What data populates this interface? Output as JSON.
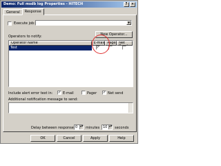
{
  "window": {
    "title": "Demo: Full msdb log Properties - HITECH",
    "buttons": {
      "help": "?",
      "close": "×"
    }
  },
  "tabs": [
    {
      "label": "General",
      "active": false
    },
    {
      "label": "Response",
      "active": true
    }
  ],
  "response": {
    "execute_job_label": "Execute job:",
    "execute_job_checked": false,
    "execute_job_value": "",
    "operators_label": "Operators to notify:",
    "new_operator_button": "New Operator...",
    "grid": {
      "headers": [
        "Operator Name",
        "E-mail",
        "Pager",
        "Net Send"
      ],
      "rows": [
        {
          "name": "Test",
          "email": true,
          "pager": false,
          "netsend": false
        }
      ]
    },
    "include_error_label": "Include alert error text in:",
    "include_email": "E-mail",
    "include_pager": "Pager",
    "include_netsend": "Net send",
    "include_email_checked": true,
    "include_pager_checked": false,
    "include_netsend_checked": true,
    "additional_message_label": "Additional notification message to send:",
    "additional_message_value": "",
    "delay_label": "Delay between responses:",
    "delay_minutes": "0",
    "minutes_label": "minutes",
    "delay_seconds": "10",
    "seconds_label": "seconds"
  },
  "footer": {
    "ok": "OK",
    "cancel": "Cancel",
    "apply": "Apply",
    "help": "Help"
  },
  "colors": {
    "title_start": "#0a246a",
    "title_end": "#a6caf0",
    "selection": "#0a246a",
    "face": "#d4d0c8",
    "highlight_circle": "#e03030"
  }
}
